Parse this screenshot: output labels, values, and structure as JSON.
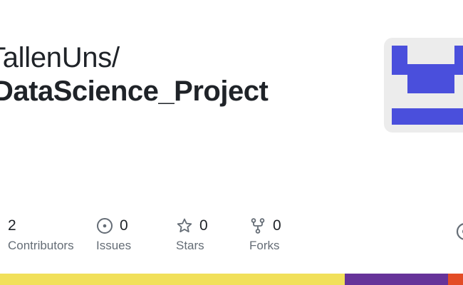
{
  "repo": {
    "owner_path": "TallenUns/",
    "name": "DataScience_Project"
  },
  "stats": {
    "contributors": {
      "value": "2",
      "label": "Contributors"
    },
    "issues": {
      "value": "0",
      "label": "Issues",
      "icon": "issue-opened-icon"
    },
    "stars": {
      "value": "0",
      "label": "Stars",
      "icon": "star-icon"
    },
    "forks": {
      "value": "0",
      "label": "Forks",
      "icon": "repo-forked-icon"
    }
  },
  "avatar": {
    "icon": "identicon",
    "color": "#4a4fdc",
    "background": "#ececec"
  },
  "languages": [
    {
      "color": "#f1e05a",
      "share": 0.745
    },
    {
      "color": "#663399",
      "share": 0.222
    },
    {
      "color": "#e34c26",
      "share": 0.033
    }
  ],
  "colors": {
    "text": "#1f2328",
    "muted": "#656d76"
  }
}
